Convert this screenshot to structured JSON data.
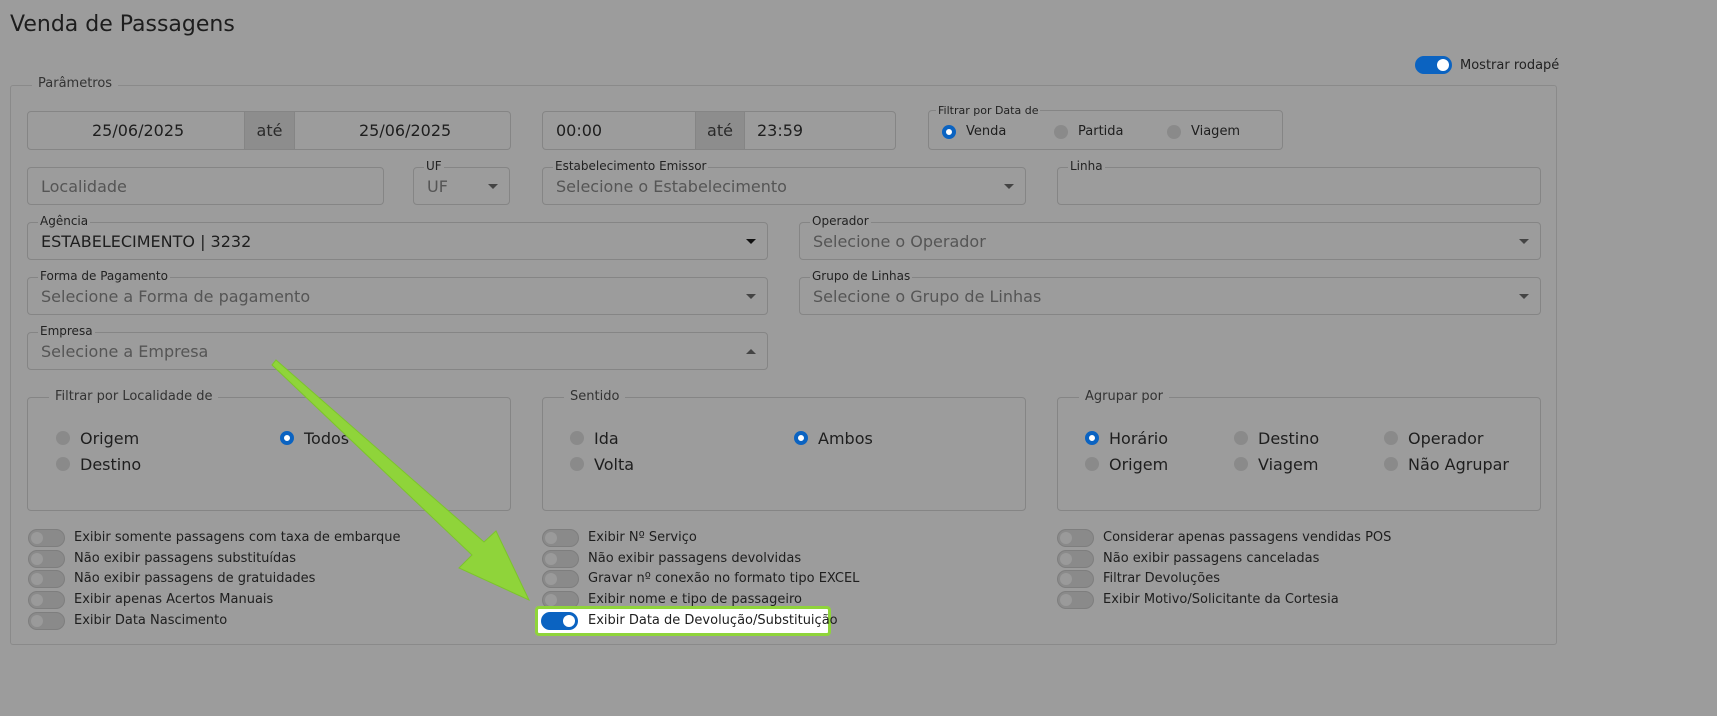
{
  "page_title": "Venda de Passagens",
  "footer_toggle": {
    "label": "Mostrar rodapé",
    "on": true
  },
  "params_legend": "Parâmetros",
  "date_range": {
    "from": "25/06/2025",
    "separator": "até",
    "to": "25/06/2025"
  },
  "time_range": {
    "from": "00:00",
    "separator": "até",
    "to": "23:59"
  },
  "date_filter": {
    "legend": "Filtrar por Data de",
    "options": [
      {
        "label": "Venda",
        "selected": true
      },
      {
        "label": "Partida",
        "selected": false
      },
      {
        "label": "Viagem",
        "selected": false
      }
    ]
  },
  "localidade": {
    "placeholder": "Localidade"
  },
  "uf": {
    "label": "UF",
    "placeholder": "UF"
  },
  "estabelecimento": {
    "label": "Estabelecimento Emissor",
    "placeholder": "Selecione o Estabelecimento"
  },
  "linha": {
    "label": "Linha",
    "value": ""
  },
  "agencia": {
    "label": "Agência",
    "value": "ESTABELECIMENTO | 3232"
  },
  "operador": {
    "label": "Operador",
    "placeholder": "Selecione o Operador"
  },
  "forma_pagamento": {
    "label": "Forma de Pagamento",
    "placeholder": "Selecione a Forma de pagamento"
  },
  "grupo_linhas": {
    "label": "Grupo de Linhas",
    "placeholder": "Selecione o Grupo de Linhas"
  },
  "empresa": {
    "label": "Empresa",
    "placeholder": "Selecione a Empresa"
  },
  "localidade_filter": {
    "legend": "Filtrar por Localidade de",
    "options": [
      {
        "label": "Origem",
        "selected": false
      },
      {
        "label": "Todos",
        "selected": true
      },
      {
        "label": "Destino",
        "selected": false
      }
    ]
  },
  "sentido": {
    "legend": "Sentido",
    "options": [
      {
        "label": "Ida",
        "selected": false
      },
      {
        "label": "Ambos",
        "selected": true
      },
      {
        "label": "Volta",
        "selected": false
      }
    ]
  },
  "agrupar": {
    "legend": "Agrupar por",
    "options": [
      {
        "label": "Horário",
        "selected": true
      },
      {
        "label": "Destino",
        "selected": false
      },
      {
        "label": "Operador",
        "selected": false
      },
      {
        "label": "Origem",
        "selected": false
      },
      {
        "label": "Viagem",
        "selected": false
      },
      {
        "label": "Não Agrupar",
        "selected": false
      }
    ]
  },
  "switches_col1": [
    {
      "label": "Exibir somente passagens com taxa de embarque",
      "on": false
    },
    {
      "label": "Não exibir passagens substituídas",
      "on": false
    },
    {
      "label": "Não exibir passagens de gratuidades",
      "on": false
    },
    {
      "label": "Exibir apenas Acertos Manuais",
      "on": false
    },
    {
      "label": "Exibir Data Nascimento",
      "on": false
    }
  ],
  "switches_col2": [
    {
      "label": "Exibir Nº Serviço",
      "on": false
    },
    {
      "label": "Não exibir passagens devolvidas",
      "on": false
    },
    {
      "label": "Gravar nº conexão no formato tipo EXCEL",
      "on": false
    },
    {
      "label": "Exibir nome e tipo de passageiro",
      "on": false
    },
    {
      "label": "Exibir Data de Devolução/Substituição",
      "on": true
    }
  ],
  "switches_col3": [
    {
      "label": "Considerar apenas passagens vendidas POS",
      "on": false
    },
    {
      "label": "Não exibir passagens canceladas",
      "on": false
    },
    {
      "label": "Filtrar Devoluções",
      "on": false
    },
    {
      "label": "Exibir Motivo/Solicitante da Cortesia",
      "on": false
    }
  ],
  "colors": {
    "accent": "#0b63c1",
    "highlight_border": "#8fd43a",
    "arrow": "#8fd43a"
  }
}
